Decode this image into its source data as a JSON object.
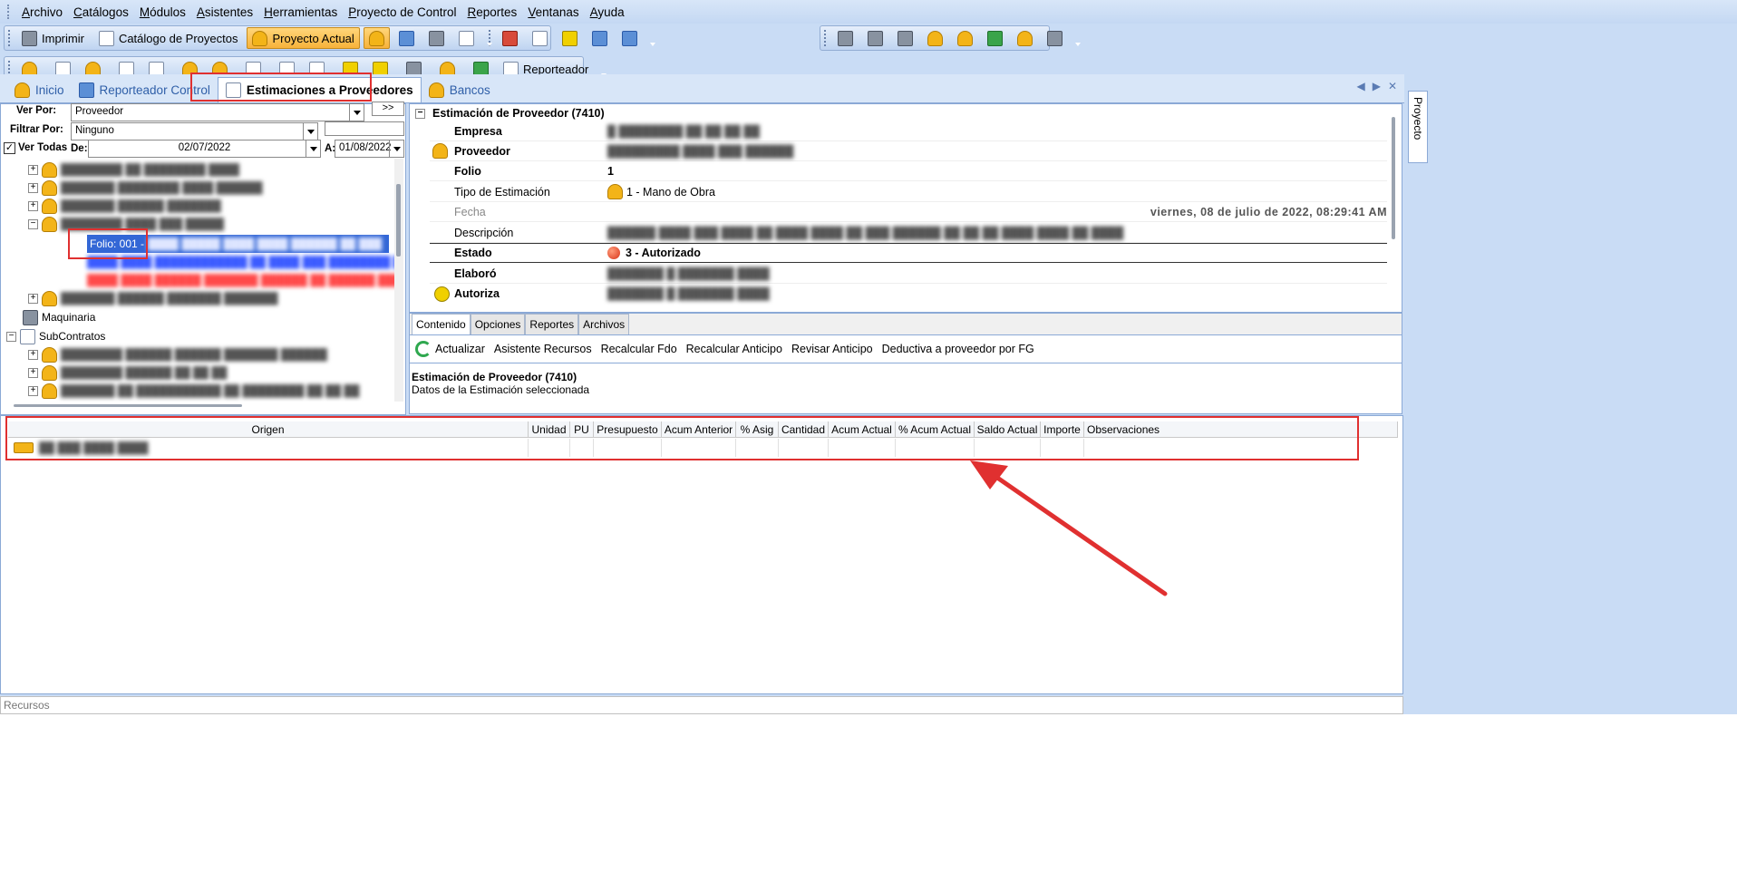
{
  "menu": [
    "Archivo",
    "Catálogos",
    "Módulos",
    "Asistentes",
    "Herramientas",
    "Proyecto de Control",
    "Reportes",
    "Ventanas",
    "Ayuda"
  ],
  "toolbar1": {
    "imprimir": "Imprimir",
    "catalogo": "Catálogo de Proyectos",
    "proyecto_actual": "Proyecto Actual"
  },
  "toolbar2": {
    "reporteador": "Reporteador"
  },
  "tabs": {
    "inicio": "Inicio",
    "reporteador_control": "Reporteador Control",
    "estimaciones": "Estimaciones a Proveedores",
    "bancos": "Bancos"
  },
  "side_tab": "Proyecto",
  "filters": {
    "ver_por_label": "Ver Por:",
    "ver_por_value": "Proveedor",
    "go_button": ">>",
    "filtrar_por_label": "Filtrar Por:",
    "filtrar_por_value": "Ninguno",
    "ver_todas": "Ver Todas",
    "de_label": "De:",
    "de_value": "02/07/2022",
    "a_label": "A:",
    "a_value": "01/08/2022"
  },
  "tree": {
    "folio_selected": "Folio: 001 -",
    "maquinaria": "Maquinaria",
    "subcontratos": "SubContratos"
  },
  "detail": {
    "header": "Estimación de Proveedor (7410)",
    "empresa": "Empresa",
    "proveedor": "Proveedor",
    "folio_label": "Folio",
    "folio_value": "1",
    "tipo_label": "Tipo de Estimación",
    "tipo_value": "1 - Mano de Obra",
    "fecha_label": "Fecha",
    "fecha_value": "viernes, 08 de julio de 2022, 08:29:41 AM",
    "descripcion": "Descripción",
    "estado_label": "Estado",
    "estado_value": "3 - Autorizado",
    "elaboro": "Elaboró",
    "autoriza": "Autoriza"
  },
  "subtabs": [
    "Contenido",
    "Opciones",
    "Reportes",
    "Archivos"
  ],
  "actions": [
    "Actualizar",
    "Asistente Recursos",
    "Recalcular Fdo",
    "Recalcular Anticipo",
    "Revisar Anticipo",
    "Deductiva a proveedor por FG"
  ],
  "info": {
    "title": "Estimación de Proveedor (7410)",
    "subtitle": "Datos de la Estimación seleccionada"
  },
  "grid_columns": [
    "Origen",
    "Unidad",
    "PU",
    "Presupuesto",
    "Acum Anterior",
    "% Asig",
    "Cantidad",
    "Acum Actual",
    "% Acum Actual",
    "Saldo Actual",
    "Importe",
    "Observaciones"
  ],
  "status": "Recursos",
  "colors": {
    "accent_red": "#e03030",
    "selection": "#3367d6",
    "active_tab": "#f7b23a"
  }
}
